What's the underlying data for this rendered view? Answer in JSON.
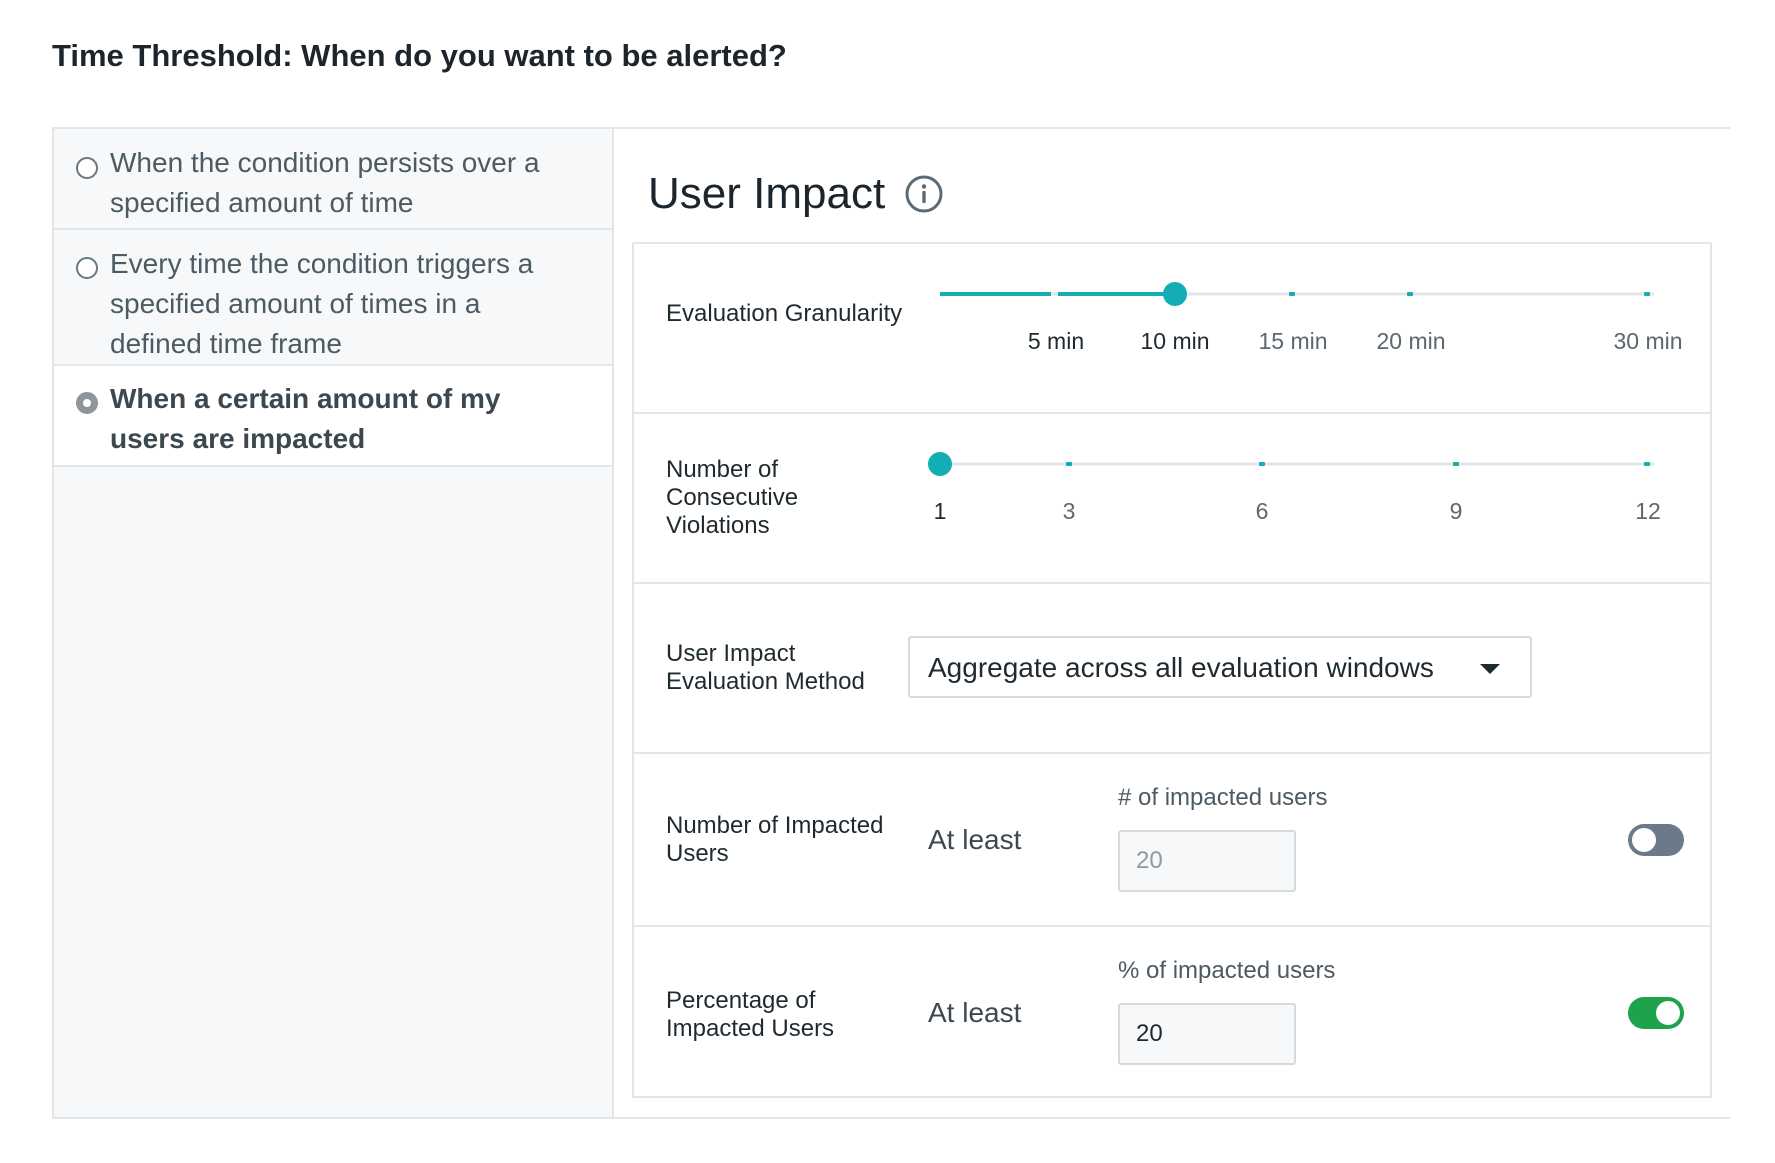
{
  "page": {
    "title": "Time Threshold: When do you want to be alerted?"
  },
  "threshold_options": [
    {
      "label": "When the condition persists over a specified amount of time",
      "selected": false
    },
    {
      "label": "Every time the condition triggers a specified amount of times in a defined time frame",
      "selected": false
    },
    {
      "label": "When a certain amount of my users are impacted",
      "selected": true
    }
  ],
  "user_impact": {
    "title": "User Impact",
    "info_icon": "info-circle-icon",
    "evaluation_granularity": {
      "label": "Evaluation Granularity",
      "ticks": [
        "5 min",
        "10 min",
        "15 min",
        "20 min",
        "30 min"
      ],
      "selected": "10 min"
    },
    "consecutive_violations": {
      "label": "Number of Consecutive Violations",
      "ticks": [
        "1",
        "3",
        "6",
        "9",
        "12"
      ],
      "selected": "1"
    },
    "evaluation_method": {
      "label": "User Impact Evaluation Method",
      "value": "Aggregate across all evaluation windows",
      "caret_icon": "caret-down-icon"
    },
    "impacted_users": {
      "label": "Number of Impacted Users",
      "qualifier": "At least",
      "field_label": "# of impacted users",
      "value": "20",
      "enabled": false
    },
    "impacted_percentage": {
      "label": "Percentage of Impacted Users",
      "qualifier": "At least",
      "field_label": "% of impacted users",
      "value": "20",
      "enabled": true
    }
  },
  "colors": {
    "accent": "#13aeb3",
    "toggle_on": "#1fa34a",
    "toggle_off": "#6b7988",
    "track": "#e0e5e8"
  }
}
